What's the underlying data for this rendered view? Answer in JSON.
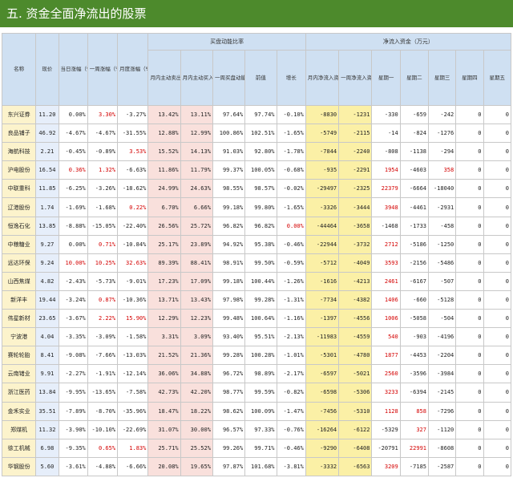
{
  "title": "五. 资金全面净流出的股票",
  "groups": {
    "buy_sell": "买盘动能比率",
    "net_inflow": "净流入资金（万元）"
  },
  "columns": [
    "名称",
    "现价",
    "当日涨幅（%）",
    "一周涨幅（%）",
    "月度涨幅（%）",
    "月内主动卖出占比",
    "月内主动买入占比",
    "一周买盘动能",
    "前值",
    "增长",
    "月内净流入资金",
    "一周净流入资金",
    "星期一",
    "星期二",
    "星期三",
    "星期四",
    "星期五"
  ],
  "rows": [
    {
      "cells": [
        "东兴证券",
        "11.20",
        "0.00%",
        "3.30%",
        "-3.27%",
        "13.42%",
        "13.11%",
        "97.64%",
        "97.74%",
        "-0.10%",
        "-8830",
        "-1231",
        "-330",
        "-659",
        "-242",
        "0",
        "0"
      ],
      "red": [
        3
      ]
    },
    {
      "cells": [
        "良品铺子",
        "46.92",
        "-4.67%",
        "-4.67%",
        "-31.55%",
        "12.88%",
        "12.99%",
        "100.86%",
        "102.51%",
        "-1.65%",
        "-5749",
        "-2115",
        "-14",
        "-824",
        "-1276",
        "0",
        "0"
      ],
      "red": []
    },
    {
      "cells": [
        "海航科技",
        "2.21",
        "-0.45%",
        "-0.89%",
        "3.53%",
        "15.52%",
        "14.13%",
        "91.03%",
        "92.80%",
        "-1.78%",
        "-7844",
        "-2240",
        "-808",
        "-1138",
        "-294",
        "0",
        "0"
      ],
      "red": [
        4
      ]
    },
    {
      "cells": [
        "沪电股份",
        "16.54",
        "0.36%",
        "1.32%",
        "-6.63%",
        "11.86%",
        "11.79%",
        "99.37%",
        "100.05%",
        "-0.68%",
        "-935",
        "-2291",
        "1954",
        "-4603",
        "358",
        "0",
        "0"
      ],
      "red": [
        2,
        3,
        12,
        14
      ]
    },
    {
      "cells": [
        "中联重科",
        "11.85",
        "-6.25%",
        "-3.26%",
        "-18.62%",
        "24.99%",
        "24.63%",
        "98.55%",
        "98.57%",
        "-0.02%",
        "-29497",
        "-2325",
        "22379",
        "-6664",
        "-18040",
        "0",
        "0"
      ],
      "red": [
        12
      ]
    },
    {
      "cells": [
        "辽港股份",
        "1.74",
        "-1.69%",
        "-1.68%",
        "0.22%",
        "6.70%",
        "6.66%",
        "99.18%",
        "99.80%",
        "-1.65%",
        "-3326",
        "-3444",
        "3948",
        "-4461",
        "-2931",
        "0",
        "0"
      ],
      "red": [
        4,
        12
      ]
    },
    {
      "cells": [
        "恒逸石化",
        "13.85",
        "-8.88%",
        "-15.05%",
        "-22.40%",
        "26.56%",
        "25.72%",
        "96.82%",
        "96.82%",
        "0.00%",
        "-44464",
        "-3658",
        "-1468",
        "-1733",
        "-458",
        "0",
        "0"
      ],
      "red": [
        9
      ]
    },
    {
      "cells": [
        "中粮糖业",
        "9.27",
        "0.00%",
        "0.71%",
        "-10.84%",
        "25.17%",
        "23.89%",
        "94.92%",
        "95.38%",
        "-0.46%",
        "-22944",
        "-3732",
        "2712",
        "-5186",
        "-1250",
        "0",
        "0"
      ],
      "red": [
        3,
        12
      ]
    },
    {
      "cells": [
        "远达环保",
        "9.24",
        "10.00%",
        "10.25%",
        "32.63%",
        "89.39%",
        "88.41%",
        "98.91%",
        "99.50%",
        "-0.59%",
        "-5712",
        "-4049",
        "3593",
        "-2156",
        "-5486",
        "0",
        "0"
      ],
      "red": [
        2,
        3,
        4,
        12
      ]
    },
    {
      "cells": [
        "山西焦煤",
        "4.82",
        "-2.43%",
        "-5.73%",
        "-9.01%",
        "17.23%",
        "17.09%",
        "99.18%",
        "100.44%",
        "-1.26%",
        "-1616",
        "-4213",
        "2461",
        "-6167",
        "-507",
        "0",
        "0"
      ],
      "red": [
        12
      ]
    },
    {
      "cells": [
        "新洋丰",
        "19.44",
        "-3.24%",
        "0.87%",
        "-10.36%",
        "13.71%",
        "13.43%",
        "97.98%",
        "99.28%",
        "-1.31%",
        "-7734",
        "-4382",
        "1406",
        "-660",
        "-5128",
        "0",
        "0"
      ],
      "red": [
        3,
        12
      ]
    },
    {
      "cells": [
        "伟星新材",
        "23.65",
        "-3.67%",
        "2.22%",
        "15.90%",
        "12.29%",
        "12.23%",
        "99.48%",
        "100.64%",
        "-1.16%",
        "-1397",
        "-4556",
        "1006",
        "-5058",
        "-504",
        "0",
        "0"
      ],
      "red": [
        3,
        4,
        12
      ]
    },
    {
      "cells": [
        "宁波港",
        "4.04",
        "-3.35%",
        "-3.09%",
        "-1.58%",
        "3.31%",
        "3.09%",
        "93.40%",
        "95.51%",
        "-2.13%",
        "-11983",
        "-4559",
        "540",
        "-903",
        "-4196",
        "0",
        "0"
      ],
      "red": [
        12
      ]
    },
    {
      "cells": [
        "赛轮轮胎",
        "8.41",
        "-9.08%",
        "-7.66%",
        "-13.03%",
        "21.52%",
        "21.36%",
        "99.28%",
        "100.28%",
        "-1.01%",
        "-5301",
        "-4780",
        "1877",
        "-4453",
        "-2204",
        "0",
        "0"
      ],
      "red": [
        12
      ]
    },
    {
      "cells": [
        "云南锗业",
        "9.91",
        "-2.27%",
        "-1.91%",
        "-12.14%",
        "36.06%",
        "34.88%",
        "96.72%",
        "98.89%",
        "-2.17%",
        "-6597",
        "-5021",
        "2560",
        "-3596",
        "-3984",
        "0",
        "0"
      ],
      "red": [
        12
      ]
    },
    {
      "cells": [
        "浙江医药",
        "13.84",
        "-9.95%",
        "-13.65%",
        "-7.58%",
        "42.73%",
        "42.20%",
        "98.77%",
        "99.59%",
        "-0.82%",
        "-6598",
        "-5306",
        "3233",
        "-6394",
        "-2145",
        "0",
        "0"
      ],
      "red": [
        12
      ]
    },
    {
      "cells": [
        "金禾实业",
        "35.51",
        "-7.89%",
        "-8.70%",
        "-35.96%",
        "18.47%",
        "18.22%",
        "98.62%",
        "100.09%",
        "-1.47%",
        "-7456",
        "-5310",
        "1128",
        "858",
        "-7296",
        "0",
        "0"
      ],
      "red": [
        12,
        13
      ]
    },
    {
      "cells": [
        "郑煤机",
        "11.32",
        "-3.90%",
        "-10.10%",
        "-22.69%",
        "31.07%",
        "30.00%",
        "96.57%",
        "97.33%",
        "-0.76%",
        "-16264",
        "-6122",
        "-5329",
        "327",
        "-1120",
        "0",
        "0"
      ],
      "red": [
        13
      ]
    },
    {
      "cells": [
        "徐工机械",
        "6.98",
        "-9.35%",
        "0.65%",
        "1.83%",
        "25.71%",
        "25.52%",
        "99.26%",
        "99.71%",
        "-0.46%",
        "-9290",
        "-6408",
        "-20791",
        "22991",
        "-8608",
        "0",
        "0"
      ],
      "red": [
        3,
        4,
        13
      ]
    },
    {
      "cells": [
        "华钢股份",
        "5.60",
        "-3.61%",
        "-4.88%",
        "-6.66%",
        "20.08%",
        "19.65%",
        "97.87%",
        "101.68%",
        "-3.81%",
        "-3332",
        "-6563",
        "3209",
        "-7185",
        "-2587",
        "0",
        "0"
      ],
      "red": [
        12
      ]
    }
  ]
}
